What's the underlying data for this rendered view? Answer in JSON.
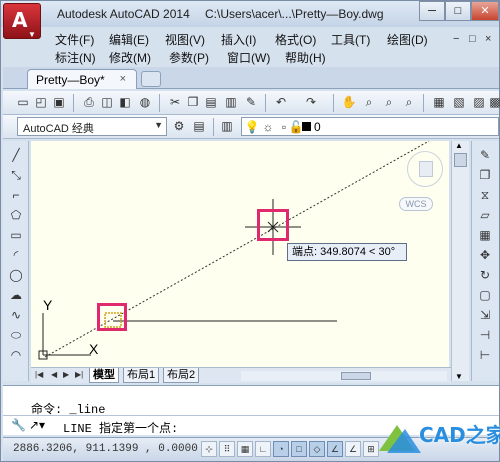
{
  "app": {
    "title": "Autodesk AutoCAD 2014",
    "file_path": "C:\\Users\\acer\\...\\Pretty—Boy.dwg"
  },
  "window_controls": {
    "minimize": "─",
    "maximize": "□",
    "close": "✕"
  },
  "menu": {
    "row1": [
      "文件(F)",
      "编辑(E)",
      "视图(V)",
      "插入(I)",
      "格式(O)",
      "工具(T)",
      "绘图(D)"
    ],
    "row2": [
      "标注(N)",
      "修改(M)",
      "参数(P)",
      "窗口(W)",
      "帮助(H)"
    ],
    "mdi_controls": [
      "−",
      "□",
      "×"
    ]
  },
  "doc_tab": {
    "label": "Pretty—Boy*",
    "close": "×"
  },
  "workspace": {
    "value": "AutoCAD 经典",
    "arrow": "▼"
  },
  "layer": {
    "name": "0"
  },
  "tooltip": {
    "text": "端点: 349.8074 < 30°"
  },
  "ucs": {
    "y_label": "Y",
    "x_label": "X"
  },
  "wcs_label": "WCS",
  "layout_tabs": [
    {
      "label": "模型",
      "active": true
    },
    {
      "label": "布局1",
      "active": false
    },
    {
      "label": "布局2",
      "active": false
    }
  ],
  "command": {
    "history_line": "命令: _line",
    "prompt": "LINE 指定第一个点:"
  },
  "status": {
    "coordinates": "2886.3206, 911.1399 , 0.0000"
  },
  "watermark": {
    "text": "CAD之家"
  },
  "colors": {
    "accent_red": "#e0286e",
    "canvas_bg": "#fffff0",
    "watermark_blue": "#2a8ee0"
  }
}
